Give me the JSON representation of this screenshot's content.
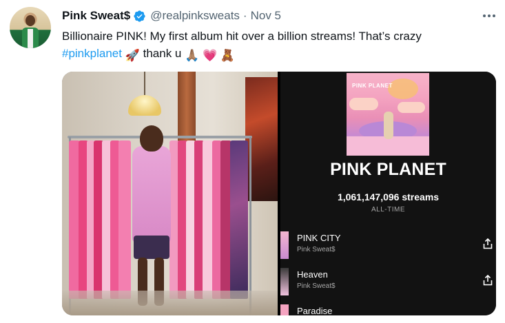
{
  "tweet": {
    "author_name": "Pink Sweat$",
    "handle": "@realpinksweats",
    "separator": "·",
    "date": "Nov 5",
    "text_line1": "Billionaire PINK! My first album hit over a billion streams! That’s crazy",
    "hashtag": "#pinkplanet",
    "text_after_hashtag": "thank u",
    "emojis": [
      "🚀",
      "🙏🏽",
      "💗",
      "🧸"
    ],
    "verified_icon": "verified-badge-icon",
    "more_icon": "more-options-icon"
  },
  "spotify": {
    "cover_text": "PINK PLANET",
    "album_title": "PINK PLANET",
    "streams": "1,061,147,096 streams",
    "period": "ALL-TIME",
    "tracks": [
      {
        "name": "PINK CITY",
        "artist": "Pink Sweat$"
      },
      {
        "name": "Heaven",
        "artist": "Pink Sweat$"
      },
      {
        "name": "Paradise",
        "artist": ""
      }
    ],
    "share_icon": "share-icon"
  },
  "colors": {
    "accent": "#1d9bf0",
    "text_primary": "#0f1419",
    "text_secondary": "#536471",
    "spotify_bg": "#121212"
  }
}
